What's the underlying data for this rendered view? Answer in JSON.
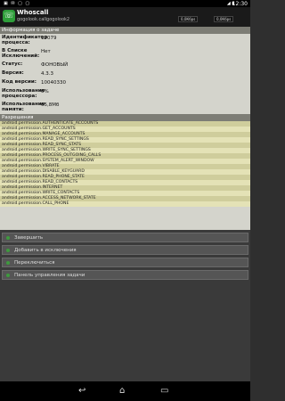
{
  "statusbar": {
    "time": "12:30",
    "speeds": [
      "0,0Кбps",
      "0,0Кбps"
    ]
  },
  "app": {
    "title": "Whoscall",
    "package": "gogolook.callgogolook2"
  },
  "info": {
    "header": "Информация о задаче",
    "rows": [
      {
        "label": "Идентификатор процесса:",
        "value": "12079"
      },
      {
        "label": "В Списке Исключений:",
        "value": "Нет"
      },
      {
        "label": "Статус:",
        "value": "ФОНОВЫЙ"
      },
      {
        "label": "Версия:",
        "value": "4.3.3"
      },
      {
        "label": "Код версии:",
        "value": "10040330"
      },
      {
        "label": "Использование процессора:",
        "value": "0%"
      },
      {
        "label": "Использование памяти:",
        "value": "65,8Мб"
      }
    ]
  },
  "permissions": {
    "header": "Разрешения",
    "items": [
      "android.permission.AUTHENTICATE_ACCOUNTS",
      "android.permission.GET_ACCOUNTS",
      "android.permission.MANAGE_ACCOUNTS",
      "android.permission.READ_SYNC_SETTINGS",
      "android.permission.READ_SYNC_STATS",
      "android.permission.WRITE_SYNC_SETTINGS",
      "android.permission.PROCESS_OUTGOING_CALLS",
      "android.permission.SYSTEM_ALERT_WINDOW",
      "android.permission.VIBRATE",
      "android.permission.DISABLE_KEYGUARD",
      "android.permission.READ_PHONE_STATE",
      "android.permission.READ_CONTACTS",
      "android.permission.INTERNET",
      "android.permission.WRITE_CONTACTS",
      "android.permission.ACCESS_NETWORK_STATE",
      "android.permission.CALL_PHONE"
    ]
  },
  "actions": [
    "Завершить",
    "Добавить в исключения",
    "Переключиться",
    "Панель управления задачи"
  ]
}
